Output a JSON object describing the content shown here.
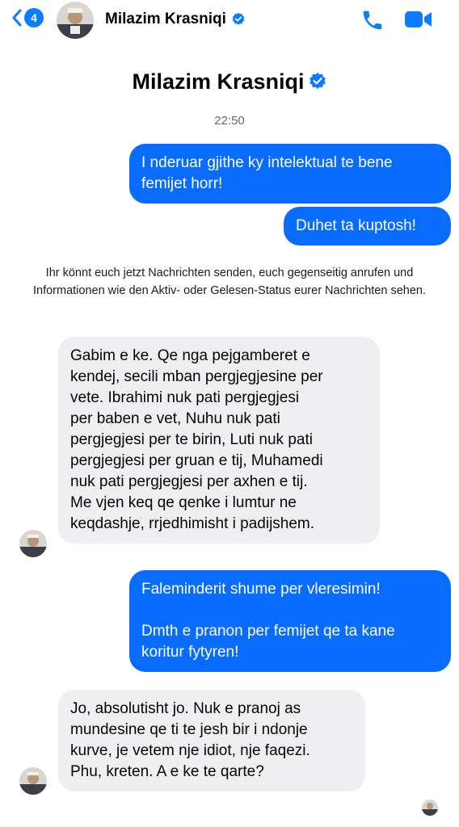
{
  "topbar": {
    "back_badge": "4",
    "contact_name": "Milazim Krasniqi"
  },
  "header": {
    "name": "Milazim Krasniqi"
  },
  "conversation": {
    "timestamp": "22:50",
    "notice": "Ihr könnt euch jetzt Nachrichten senden, euch gegenseitig anrufen und Informationen wie den Aktiv- oder Gelesen-Status eurer Nachrichten sehen.",
    "messages": [
      {
        "sender": "me",
        "text": "I nderuar gjithe ky intelektual te bene\nfemijet horr!"
      },
      {
        "sender": "me",
        "text": "Duhet ta kuptosh!"
      },
      {
        "sender": "them",
        "text": "Gabim e ke. Qe nga pejgamberet e\nkendej, secili mban pergjegjesine per\nvete. Ibrahimi nuk pati pergjegjesi\nper baben e vet, Nuhu nuk pati\npergjegjesi per te birin, Luti nuk pati\npergjegjesi per gruan e tij, Muhamedi\nnuk pati pergjegjesi per axhen e tij.\nMe vjen keq qe qenke i lumtur ne\nkeqdashje, rrjedhimisht i padijshem."
      },
      {
        "sender": "me",
        "text": "Faleminderit shume per vleresimin!\n\nDmth e pranon per femijet qe ta kane\nkoritur fytyren!"
      },
      {
        "sender": "them",
        "text": "Jo, absolutisht jo. Nuk e pranoj as\nmundesine qe ti te jesh bir i ndonje\nkurve, je vetem nje idiot, nje faqezi.\nPhu, kreten. A e ke te qarte?"
      }
    ]
  },
  "colors": {
    "accent": "#0a7cff",
    "outgoing_bubble": "#0a6cff",
    "incoming_bubble": "#efeff1"
  },
  "icons": [
    "chevron-left-icon",
    "phone-icon",
    "video-camera-icon",
    "verified-badge-icon"
  ]
}
